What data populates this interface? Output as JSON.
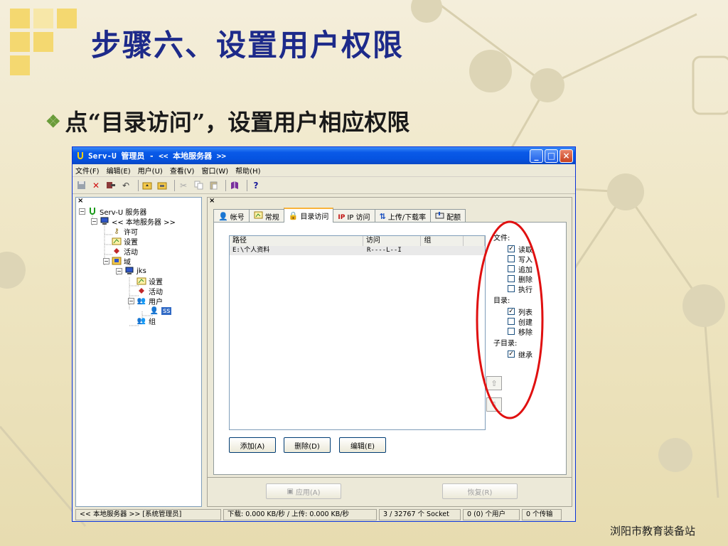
{
  "slide": {
    "title": "步骤六、设置用户权限",
    "bullet": "点“目录访问”，设置用户相应权限",
    "footer": "浏阳市教育装备站"
  },
  "window": {
    "title": "Serv-U 管理员 - << 本地服务器 >>",
    "menu": [
      "文件(F)",
      "编辑(E)",
      "用户(U)",
      "查看(V)",
      "窗口(W)",
      "帮助(H)"
    ],
    "toolbar_icons": [
      "save-icon",
      "delete-icon",
      "connect-icon",
      "undo-icon",
      "folder-up-icon",
      "folder-icon",
      "cut-icon",
      "copy-icon",
      "paste-icon",
      "book-icon",
      "help-icon"
    ]
  },
  "tree": {
    "pane_close": "×",
    "nodes": [
      {
        "label": "Serv-U 服务器",
        "icon": "serv-u-icon"
      },
      {
        "label": "<< 本地服务器 >>",
        "icon": "computer-icon"
      },
      {
        "label": "许可",
        "icon": "key-icon"
      },
      {
        "label": "设置",
        "icon": "settings-icon"
      },
      {
        "label": "活动",
        "icon": "activity-icon"
      },
      {
        "label": "域",
        "icon": "domain-icon"
      },
      {
        "label": "jks",
        "icon": "computer-icon"
      },
      {
        "label": "设置",
        "icon": "settings-icon"
      },
      {
        "label": "活动",
        "icon": "activity-icon"
      },
      {
        "label": "用户",
        "icon": "users-icon"
      },
      {
        "label": "ss",
        "icon": "user-icon"
      },
      {
        "label": "组",
        "icon": "group-icon"
      }
    ]
  },
  "right": {
    "pane_close": "×",
    "tabs": [
      {
        "label": "帐号",
        "icon": "account-icon"
      },
      {
        "label": "常规",
        "icon": "general-icon"
      },
      {
        "label": "目录访问",
        "icon": "lock-icon",
        "active": true
      },
      {
        "label": "IP 访问",
        "icon": "ip-icon"
      },
      {
        "label": "上传/下载率",
        "icon": "ratio-icon"
      },
      {
        "label": "配额",
        "icon": "quota-icon"
      }
    ],
    "columns": [
      "路径",
      "访问",
      "组"
    ],
    "rows": [
      {
        "path": "E:\\个人资料",
        "access": "R----L--I",
        "group": ""
      }
    ],
    "perm_sections": [
      {
        "title": "文件:",
        "items": [
          {
            "label": "读取",
            "checked": true
          },
          {
            "label": "写入",
            "checked": false
          },
          {
            "label": "追加",
            "checked": false
          },
          {
            "label": "删除",
            "checked": false
          },
          {
            "label": "执行",
            "checked": false
          }
        ]
      },
      {
        "title": "目录:",
        "items": [
          {
            "label": "列表",
            "checked": true
          },
          {
            "label": "创建",
            "checked": false
          },
          {
            "label": "移除",
            "checked": false
          }
        ]
      },
      {
        "title": "子目录:",
        "items": [
          {
            "label": "继承",
            "checked": true
          }
        ]
      }
    ],
    "buttons": {
      "add": "添加(A)",
      "delete": "删除(D)",
      "edit": "编辑(E)",
      "apply": "应用(A)",
      "restore": "恢复(R)"
    },
    "move_up": "⇧",
    "move_down": "⇩"
  },
  "status": {
    "server": "<< 本地服务器 >>  [系统管理员]",
    "transfer": "下载: 0.000 KB/秒 / 上传: 0.000 KB/秒",
    "sockets": "3 / 32767 个 Socket",
    "users": "0 (0) 个用户",
    "transfers": "0 个传输"
  },
  "colors": {
    "title": "#1d2a8a",
    "annotation": "#e01010",
    "accent_tab": "#f9b33b",
    "xp_blue": "#0553e0"
  }
}
